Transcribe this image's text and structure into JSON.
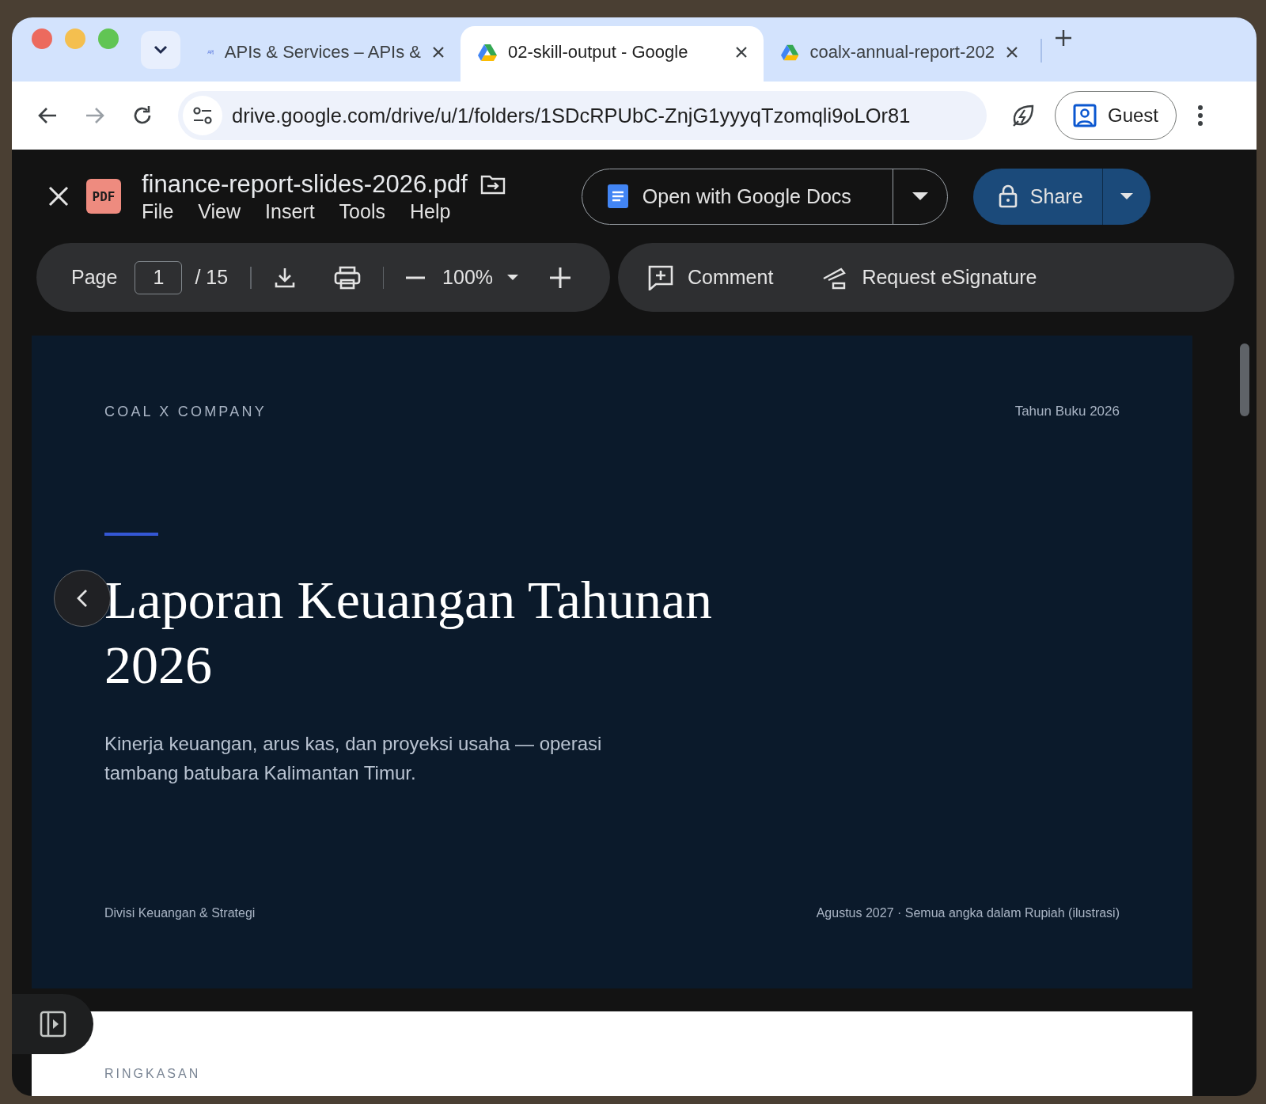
{
  "browser": {
    "tabs": [
      {
        "kind": "api",
        "title": "APIs & Services – APIs &",
        "selected": false
      },
      {
        "kind": "drive",
        "title": "02-skill-output - Google",
        "selected": true
      },
      {
        "kind": "drive",
        "title": "coalx-annual-report-202",
        "selected": false
      }
    ],
    "address": "drive.google.com/drive/u/1/folders/1SDcRPUbC-ZnjG1yyyqTzomqli9oLOr81",
    "profile": "Guest"
  },
  "viewer": {
    "file_badge": "PDF",
    "title": "finance-report-slides-2026.pdf",
    "menu": [
      "File",
      "View",
      "Insert",
      "Tools",
      "Help"
    ],
    "open_button": "Open with Google Docs",
    "share_button": "Share",
    "toolbar": {
      "page_label": "Page",
      "page_value": "1",
      "page_total": "/ 15",
      "zoom": "100%",
      "comment": "Comment",
      "esignature": "Request eSignature"
    }
  },
  "slide": {
    "company": "COAL X COMPANY",
    "year": "Tahun Buku 2026",
    "title": "Laporan Keuangan Tahunan 2026",
    "subtitle": "Kinerja keuangan, arus kas, dan proyeksi usaha — operasi tambang batubara Kalimantan Timur.",
    "footer_left": "Divisi Keuangan & Strategi",
    "footer_right": "Agustus 2027 · Semua angka dalam Rupiah (ilustrasi)"
  },
  "next_slide": {
    "heading": "RINGKASAN"
  }
}
